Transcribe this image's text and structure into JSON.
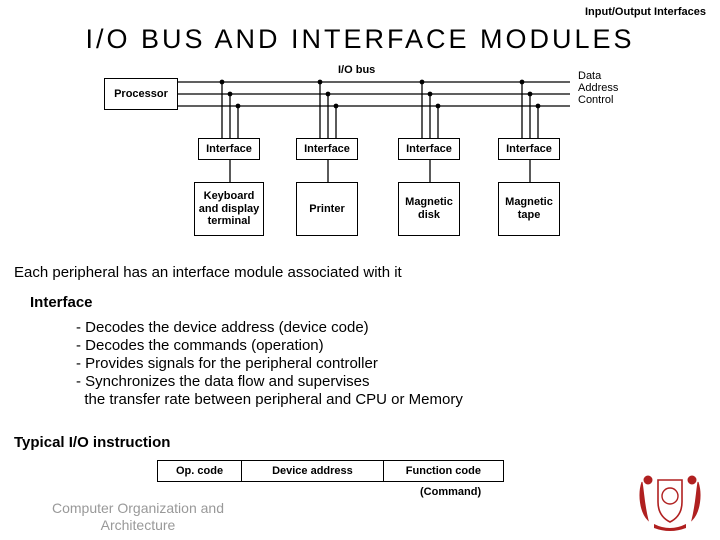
{
  "header": {
    "right": "Input/Output Interfaces"
  },
  "title": "I/O BUS AND INTERFACE MODULES",
  "diagram": {
    "bus_label": "I/O bus",
    "processor": "Processor",
    "bus_legend": [
      "Data",
      "Address",
      "Control"
    ],
    "interfaces": [
      "Interface",
      "Interface",
      "Interface",
      "Interface"
    ],
    "devices": [
      "Keyboard and display terminal",
      "Printer",
      "Magnetic disk",
      "Magnetic tape"
    ]
  },
  "body": {
    "intro": "Each peripheral has an interface module associated with it",
    "iface_title": "Interface",
    "iface_points": [
      "- Decodes the device address (device code)",
      "- Decodes the commands (operation)",
      "- Provides signals for the peripheral controller",
      "- Synchronizes the data flow and supervises",
      "  the transfer rate between peripheral and CPU or Memory"
    ],
    "instr_title": "Typical I/O instruction",
    "instr_fields": [
      "Op. code",
      "Device address",
      "Function code"
    ],
    "instr_note": "(Command)"
  },
  "footer": "Computer Organization and Architecture"
}
